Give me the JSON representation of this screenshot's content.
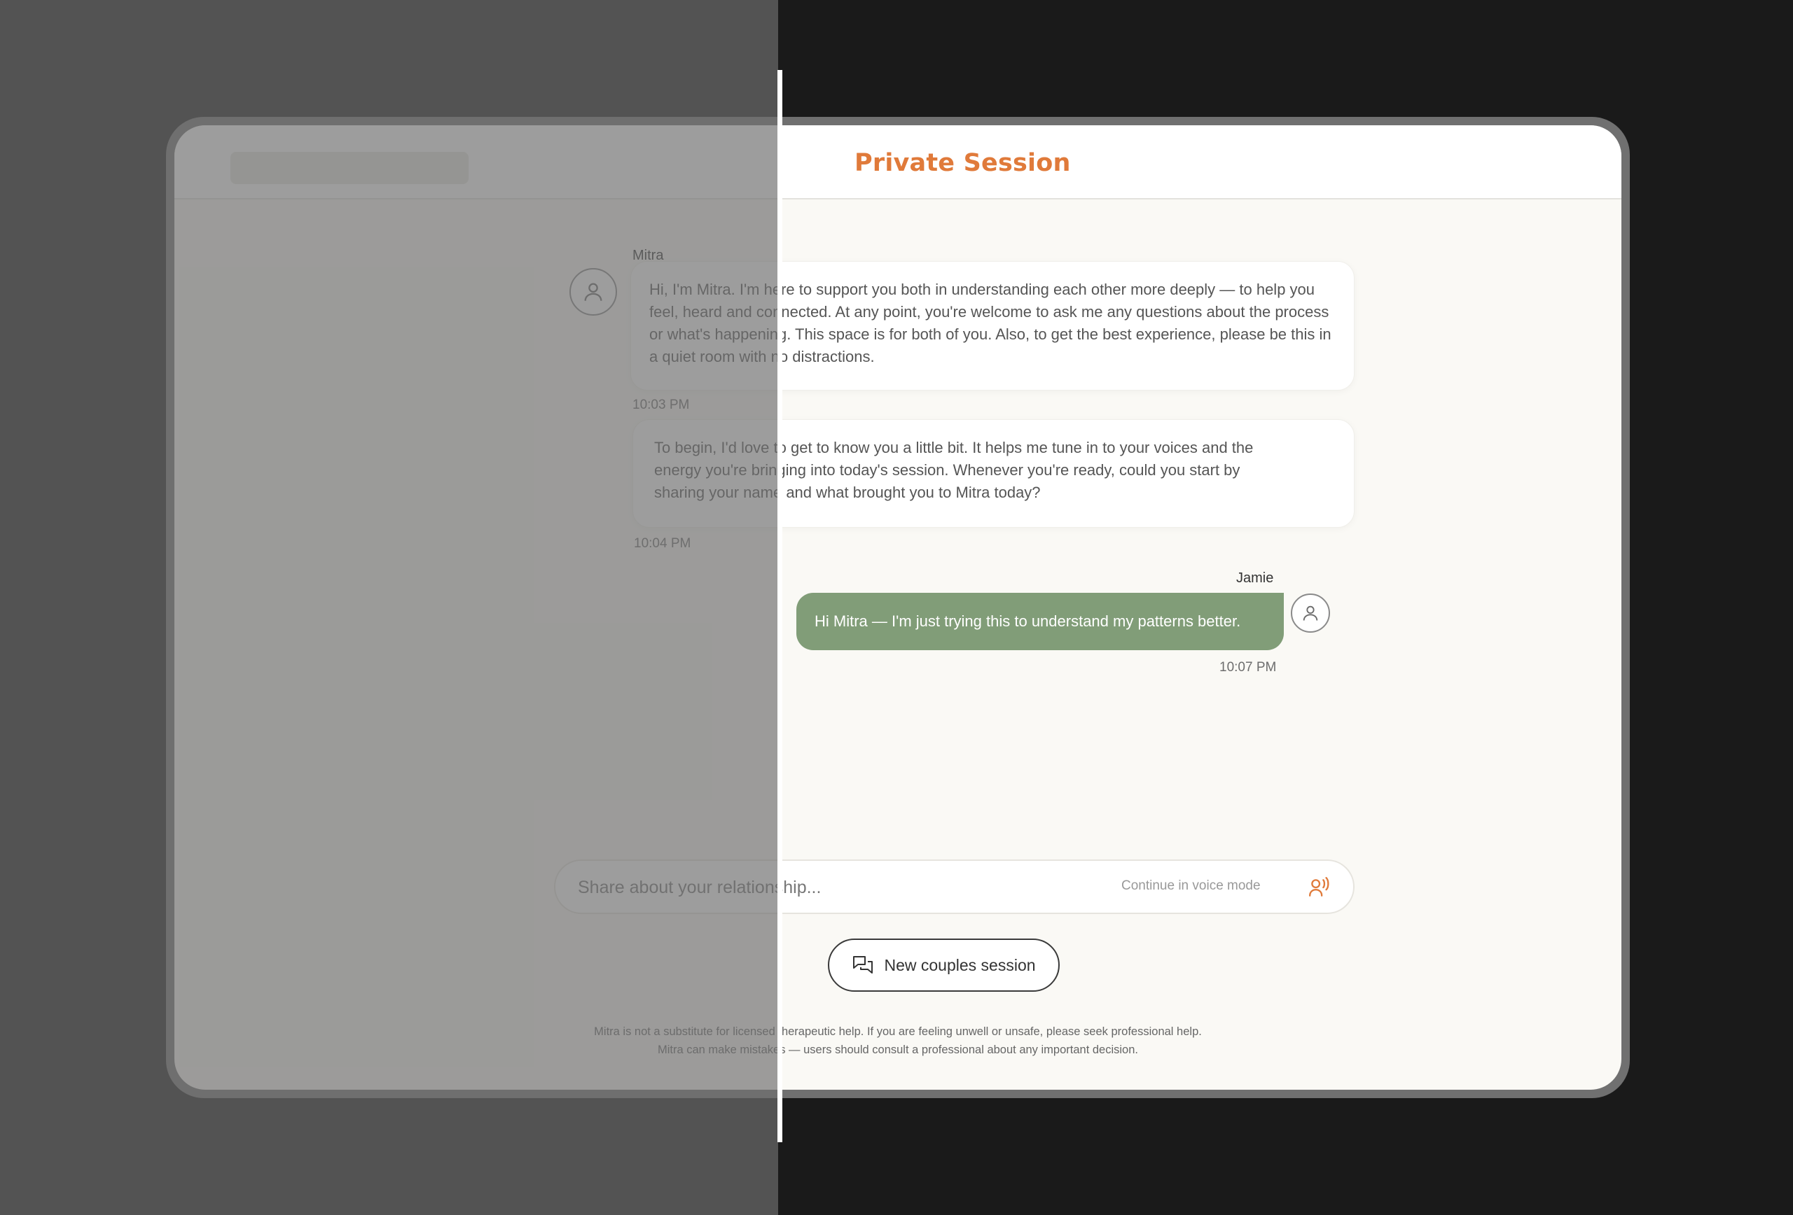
{
  "header": {
    "title": "Private Session"
  },
  "messages": {
    "mitra_sender": "Mitra",
    "bubble_1": "Hi, I'm Mitra. I'm here to support you both in understanding each other more deeply — to help you feel, heard and connected. At any point, you're welcome to ask me any questions about the process or what's happening. This space is for both of you. Also, to get the best experience, please be this in a quiet room with no distractions.",
    "time_1": "10:03 PM",
    "bubble_2": "To begin, I'd love to get to know you a little bit. It helps me tune in to your voices and the energy you're bringing into today's session. Whenever you're ready, could you start by sharing your name and what brought you to Mitra today?",
    "time_2": "10:04 PM",
    "user_sender": "Jamie",
    "user_bubble": "Hi Mitra — I'm just trying this to understand my patterns better.",
    "time_3": "10:07 PM"
  },
  "composer": {
    "placeholder": "Share about your relationship...",
    "voice_label": "Continue in voice mode"
  },
  "new_session_label": "New couples session",
  "disclaimer": {
    "line_1": "Mitra is not a substitute for licensed therapeutic help. If you are feeling unwell or unsafe, please seek professional help.",
    "line_2": "Mitra can make mistakes — users should consult a professional about any important decision."
  },
  "colors": {
    "accent": "#e07a3a",
    "user_bubble": "#819d78",
    "background": "#faf9f5"
  }
}
